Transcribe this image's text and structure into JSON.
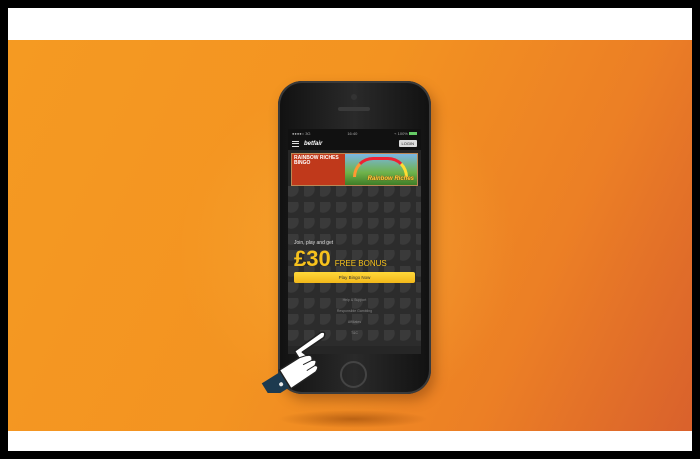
{
  "phone": {
    "status_left": "●●●●○ 3G",
    "status_time": "16:40",
    "status_right": "⌁ 100%",
    "logo": "betfair",
    "login_label": "LOGIN",
    "banner": {
      "left_text": "RAINBOW RICHES BINGO",
      "right_text": "Rainbow Riches"
    },
    "promo": {
      "join_text": "Join, play and get",
      "amount": "£30",
      "bonus_label": "FREE BONUS",
      "button_label": "Play Bingo Now"
    },
    "footer_links": [
      "Help & Support",
      "Responsible Gambling",
      "Affiliates",
      "T&C"
    ]
  },
  "colors": {
    "background_start": "#f59a22",
    "background_end": "#d9612c",
    "accent": "#f7c21d",
    "hand_cuff": "#1d3a4f"
  },
  "icons": [
    "menu-icon",
    "pointing-hand-icon",
    "home-button-icon"
  ]
}
